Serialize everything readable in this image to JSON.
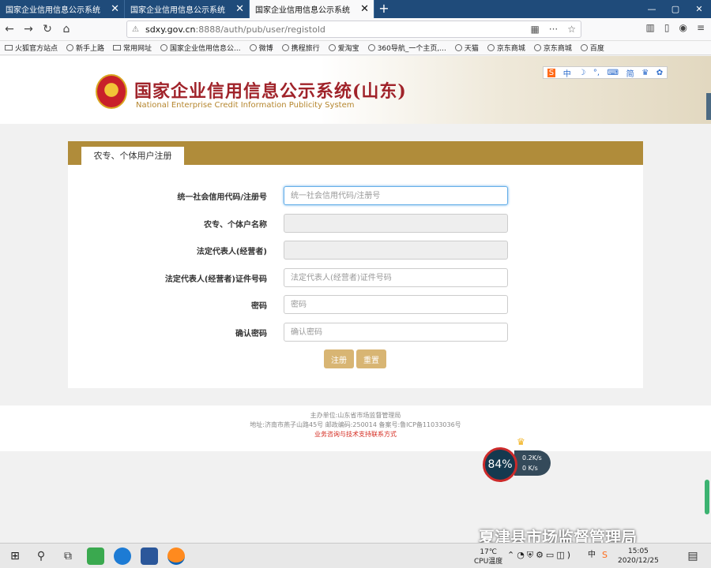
{
  "tabs": [
    {
      "title": "国家企业信用信息公示系统",
      "active": false
    },
    {
      "title": "国家企业信用信息公示系统",
      "active": false
    },
    {
      "title": "国家企业信用信息公示系统",
      "active": true
    }
  ],
  "tab_close": "✕",
  "new_tab": "+",
  "window_controls": {
    "minimize": "—",
    "maximize": "▢",
    "close": "✕"
  },
  "url": {
    "host": "sdxy.gov.cn",
    "path": ":8888/auth/pub/user/registold"
  },
  "bookmarks": [
    "火狐官方站点",
    "新手上路",
    "常用网址",
    "国家企业信用信息公...",
    "微博",
    "携程旅行",
    "爱淘宝",
    "360导航_一个主页,...",
    "天猫",
    "京东商城",
    "京东商城",
    "百度"
  ],
  "header": {
    "title_cn": "国家企业信用信息公示系统(山东)",
    "title_en": "National Enterprise Credit Information Publicity System"
  },
  "toolbar_icons": [
    "中",
    "简"
  ],
  "form": {
    "tab_label": "农专、个体用户注册",
    "fields": [
      {
        "label": "统一社会信用代码/注册号",
        "placeholder": "统一社会信用代码/注册号",
        "state": "focus"
      },
      {
        "label": "农专、个体户名称",
        "placeholder": "",
        "state": "disabled"
      },
      {
        "label": "法定代表人(经营者)",
        "placeholder": "",
        "state": "disabled"
      },
      {
        "label": "法定代表人(经营者)证件号码",
        "placeholder": "法定代表人(经营者)证件号码",
        "state": "normal"
      },
      {
        "label": "密码",
        "placeholder": "密码",
        "state": "normal"
      },
      {
        "label": "确认密码",
        "placeholder": "确认密码",
        "state": "normal"
      }
    ],
    "submit_label": "注册",
    "reset_label": "重置"
  },
  "footer": {
    "sponsor": "主办单位:山东省市场监督管理局",
    "address": "地址:济南市燕子山路45号    邮政编码:250014    备案号:鲁ICP备11033036号",
    "contact": "业务咨询与技术支持联系方式"
  },
  "net_widget": {
    "percent": "84%",
    "up": "0.2K/s",
    "down": "0 K/s"
  },
  "watermark": "夏津县市场监督管理局",
  "taskbar": {
    "temp": "17℃",
    "cpu_label": "CPU温度",
    "ime": "中",
    "time": "15:05",
    "date": "2020/12/25"
  }
}
